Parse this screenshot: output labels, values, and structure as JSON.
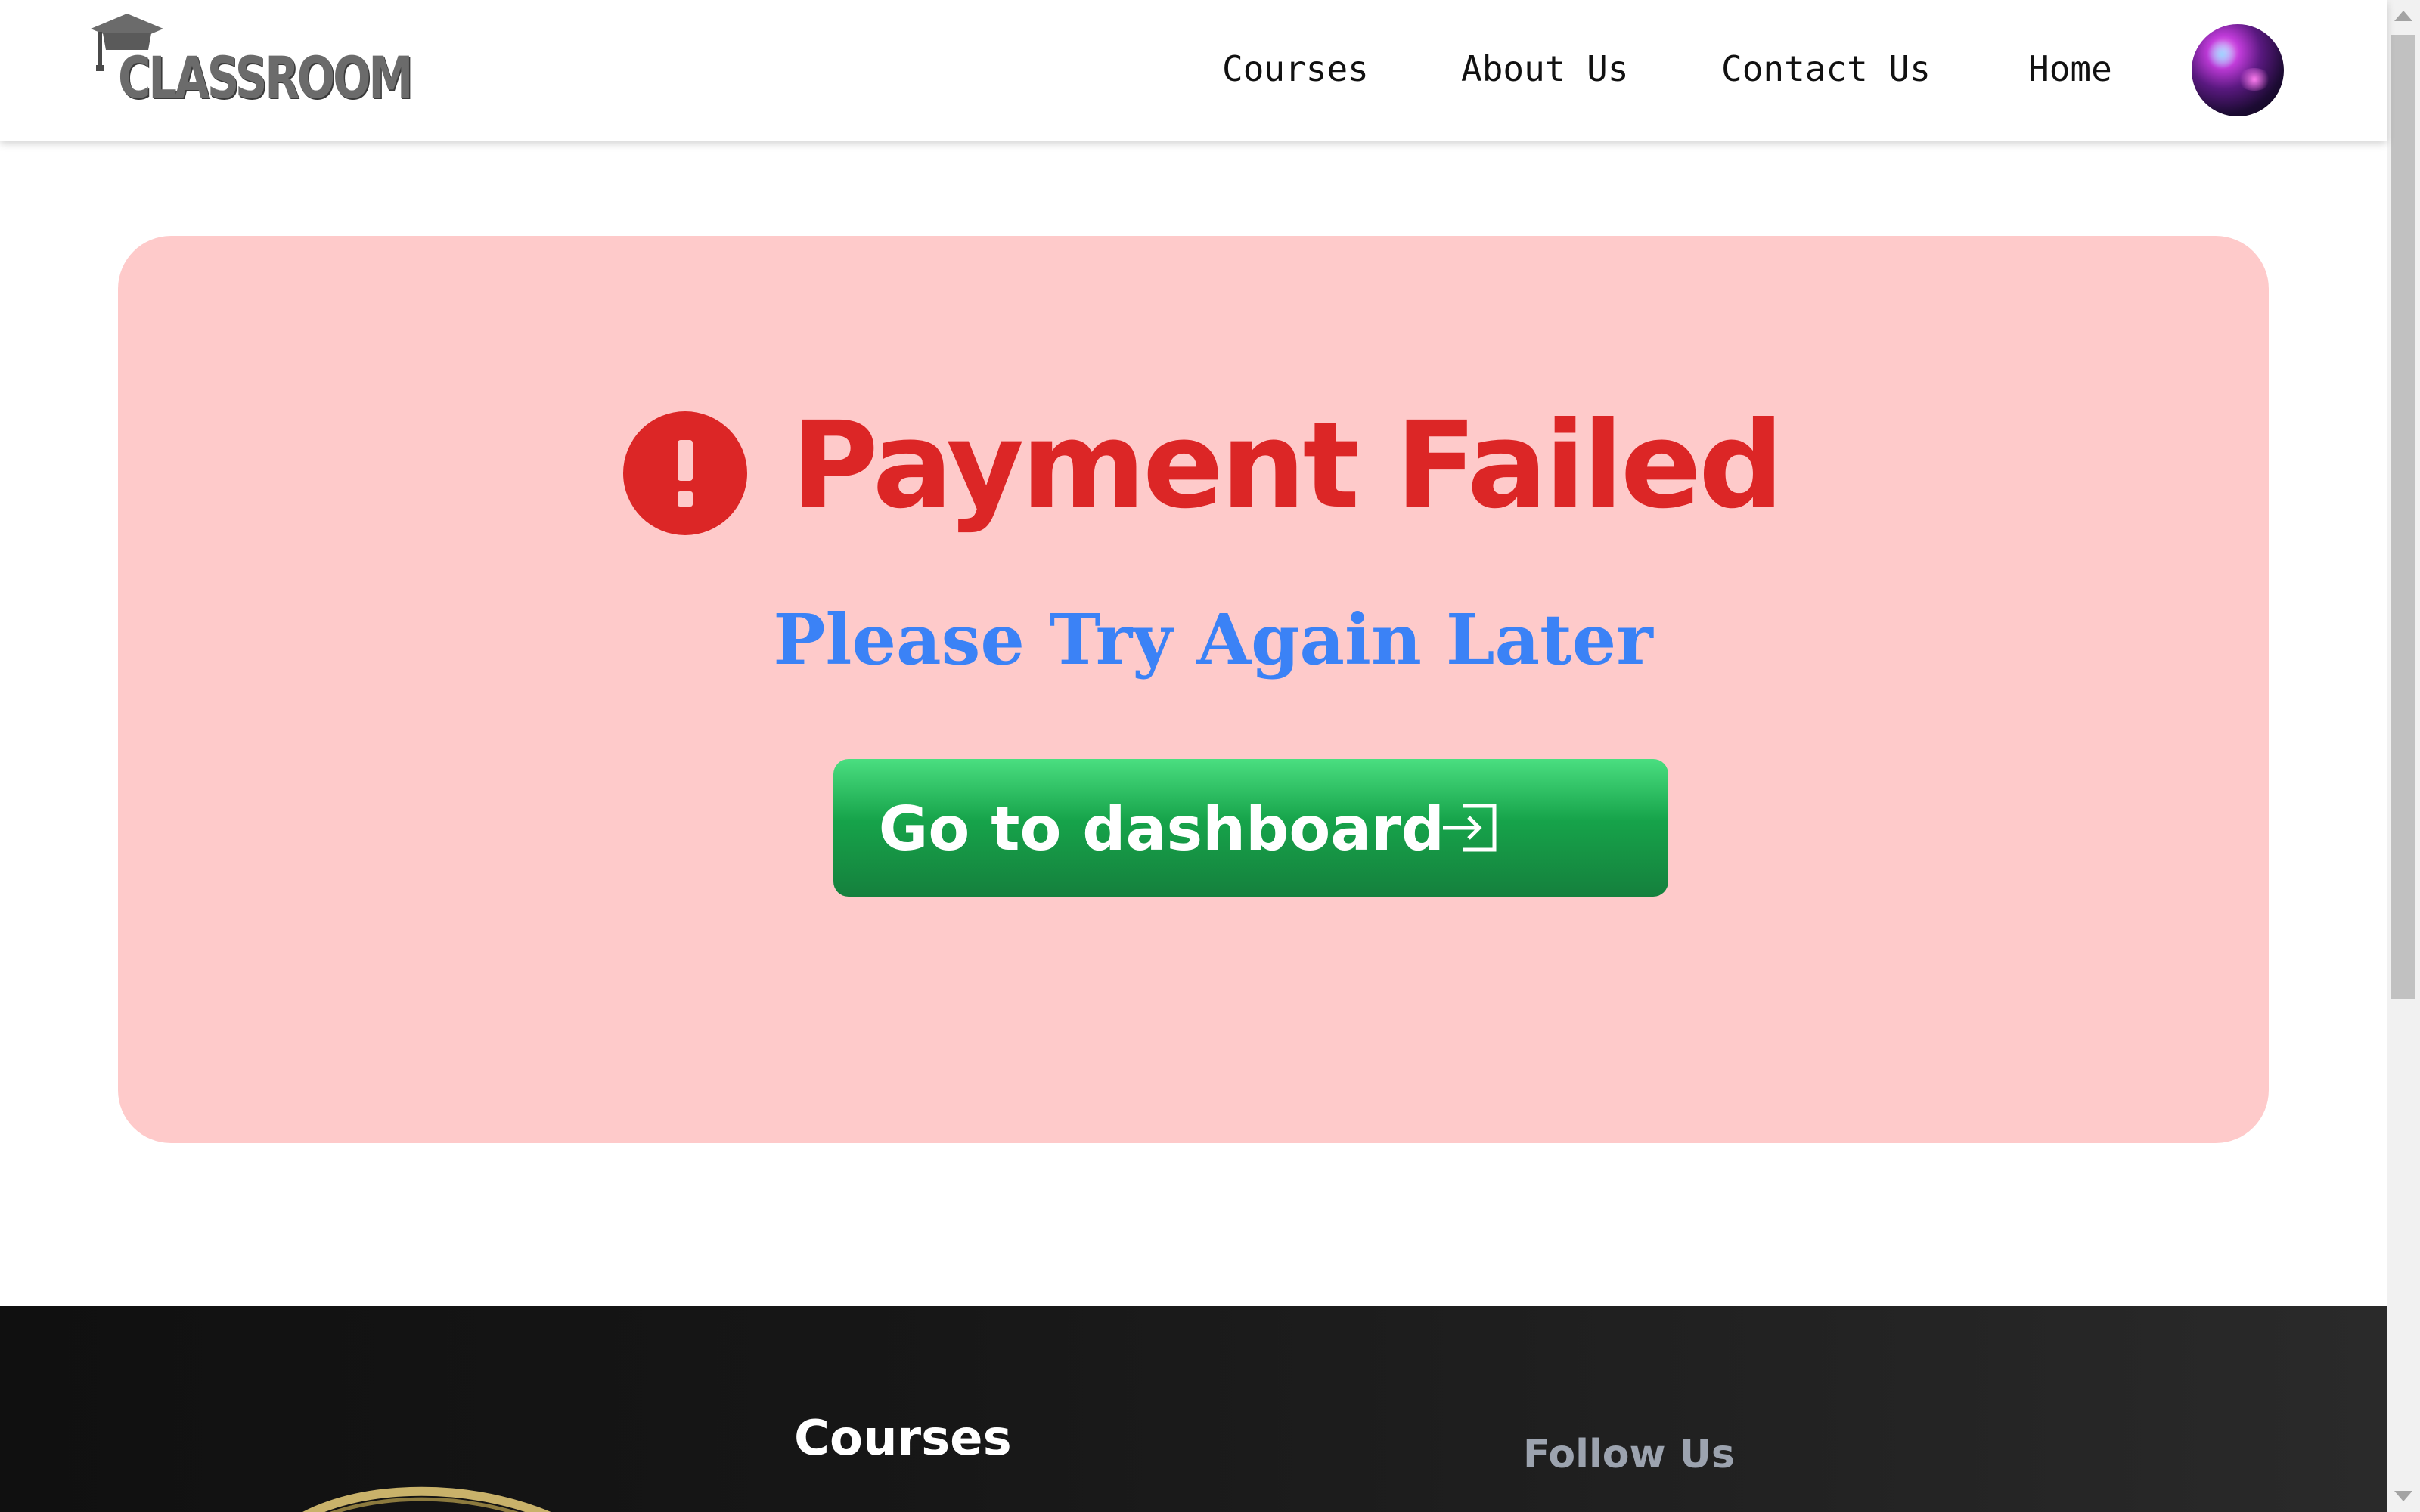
{
  "header": {
    "logo_text": "CLASSROOM",
    "nav": [
      "Courses",
      "About Us",
      "Contact Us",
      "Home"
    ],
    "avatar_icon": "user-avatar"
  },
  "card": {
    "icon": "exclamation-circle-icon",
    "title": "Payment Failed",
    "subtitle": "Please Try Again Later",
    "button_label": "Go to dashboard",
    "button_icon": "sign-in-icon"
  },
  "footer": {
    "courses_heading": "Courses",
    "follow_heading": "Follow Us"
  },
  "colors": {
    "card_background": "#fecaca",
    "title": "#dc2626",
    "subtitle": "#3b82f6",
    "button": "#16a34a",
    "footer_background": "#171717"
  }
}
